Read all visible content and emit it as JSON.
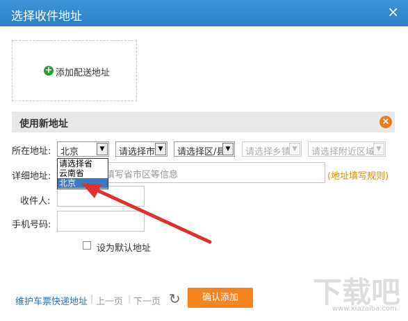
{
  "window": {
    "title": "选择收件地址",
    "close_label": "×"
  },
  "add_card": {
    "plus_icon": "+",
    "label": "添加配送地址"
  },
  "section": {
    "title": "使用新地址",
    "close_label": "×"
  },
  "form": {
    "region_label": "所在地址:",
    "province_value": "北京",
    "city_placeholder": "请选择市",
    "district_placeholder": "请选择区/县",
    "town_placeholder": "请选择乡镇",
    "nearby_placeholder": "请选择附近区域",
    "detail_label": "详细地址:",
    "detail_placeholder": "填写省市区等信息",
    "rules_link": "(地址填写规则)",
    "recipient_label": "收件人:",
    "recipient_value": "",
    "phone_label": "手机号码:",
    "phone_value": "",
    "default_label": "设为默认地址",
    "arrow_glyph": "▼"
  },
  "dropdown": {
    "options": [
      "请选择省",
      "云南省",
      "北京"
    ],
    "selected_index": 2
  },
  "footer": {
    "manage_link": "维护车票快递地址",
    "sep": "|",
    "prev": "上一页",
    "next": "下一页",
    "refresh_icon": "↻",
    "confirm": "确认添加"
  },
  "watermark": {
    "text": "下载吧",
    "url": "www.xiazaiba.com"
  },
  "colors": {
    "title_bar": "#2b7fc7",
    "accent": "#f5841f",
    "link": "#2e72b8",
    "annotation_arrow": "#e03030"
  }
}
